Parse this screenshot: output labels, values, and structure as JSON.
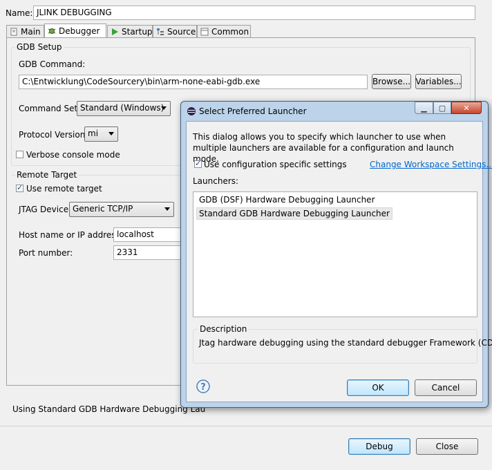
{
  "main": {
    "name_label": "Name:",
    "name_value": "JLINK DEBUGGING",
    "tabs": [
      {
        "label": "Main",
        "icon": "document-icon"
      },
      {
        "label": "Debugger",
        "icon": "bug-icon"
      },
      {
        "label": "Startup",
        "icon": "play-icon"
      },
      {
        "label": "Source",
        "icon": "source-icon"
      },
      {
        "label": "Common",
        "icon": "common-icon"
      }
    ],
    "gdb_setup": {
      "title": "GDB Setup",
      "command_label": "GDB Command:",
      "command_value": "C:\\Entwicklung\\CodeSourcery\\bin\\arm-none-eabi-gdb.exe",
      "browse_label": "Browse...",
      "variables_label": "Variables...",
      "command_set_label": "Command Set:",
      "command_set_value": "Standard (Windows)",
      "protocol_label": "Protocol Version:",
      "protocol_value": "mi",
      "verbose_label": "Verbose console mode",
      "verbose_checked": false
    },
    "remote_target": {
      "title": "Remote Target",
      "use_remote_label": "Use remote target",
      "use_remote_checked": true,
      "jtag_label": "JTAG Device:",
      "jtag_value": "Generic TCP/IP",
      "host_label": "Host name or IP address:",
      "host_value": "localhost",
      "port_label": "Port number:",
      "port_value": "2331"
    },
    "launcher_status": "Using Standard GDB Hardware Debugging Lau",
    "debug_label": "Debug",
    "close_label": "Close"
  },
  "dialog": {
    "title": "Select Preferred Launcher",
    "description": "This dialog allows you to specify which launcher to use when multiple launchers are available for a configuration and launch mode.",
    "use_config_label": "Use configuration specific settings",
    "use_config_checked": true,
    "change_workspace_link": "Change Workspace Settings...",
    "launchers_label": "Launchers:",
    "launchers": [
      "GDB (DSF) Hardware Debugging Launcher",
      "Standard GDB Hardware Debugging Launcher"
    ],
    "selected_launcher_index": 1,
    "description_title": "Description",
    "description_text": "Jtag hardware debugging using the standard debugger Framework (CDI).",
    "ok_label": "OK",
    "cancel_label": "Cancel",
    "help_icon": "help-icon",
    "colors": {
      "accent": "#3c7fb1",
      "link": "#0066cc"
    }
  }
}
